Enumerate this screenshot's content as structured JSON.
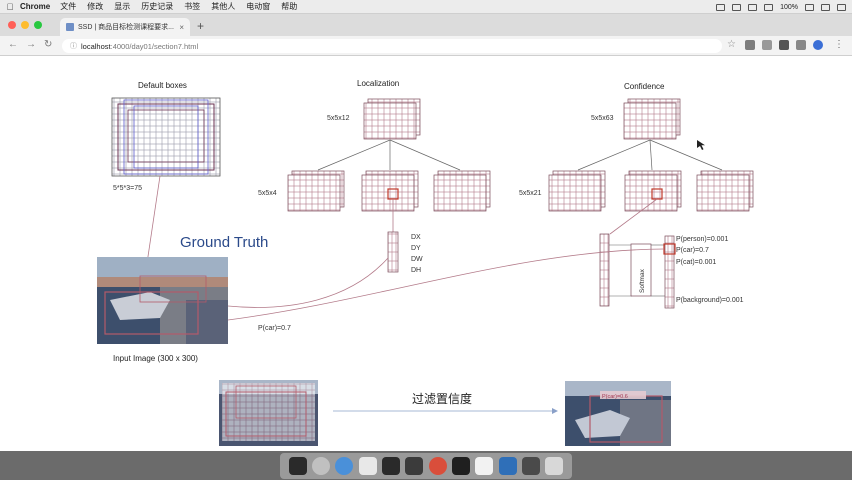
{
  "menubar": {
    "app_name": "Chrome",
    "items": [
      "文件",
      "修改",
      "显示",
      "历史记录",
      "书签",
      "其他人",
      "电动窗",
      "帮助"
    ],
    "status": "100%"
  },
  "browser": {
    "tab_title": "SSD | 商品目标检测课程要求...",
    "url_host": "localhost",
    "url_path": ":4000/day01/section7.html"
  },
  "slide": {
    "default_boxes_title": "Default boxes",
    "default_boxes_formula": "5*5*3=75",
    "localization_title": "Localization",
    "loc_top_dim": "5x5x12",
    "loc_left_dim": "5x5x4",
    "confidence_title": "Confidence",
    "conf_top_dim": "5x5x63",
    "conf_left_dim": "5x5x21",
    "ground_truth": "Ground Truth",
    "offsets": [
      "DX",
      "DY",
      "DW",
      "DH"
    ],
    "softmax": "Softmax",
    "probs": [
      "P(person)=0.001",
      "P(car)=0.7",
      "P(cat)=0.001",
      "P(background)=0.001"
    ],
    "p_car_label": "P(car)=0.7",
    "input_caption": "Input Image (300 x 300)",
    "filter_label": "过滤置信度",
    "result_badge": "P(car)=0.6"
  }
}
